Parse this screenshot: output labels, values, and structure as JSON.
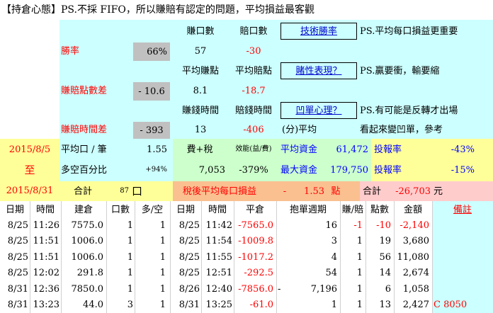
{
  "title": "【持倉心態】PS.不採 FIFO，所以賺賠有認定的問題，平均損益最客觀",
  "buttons": {
    "tech_win": "技術勝率",
    "gamble": "賭性表現？",
    "pit": "凹單心理？"
  },
  "notes": {
    "avg_pnl": "PS.平均每口損益更重要",
    "big_win": "PS.贏要衝，輸要縮",
    "reverse": "PS.有可能是反轉才出場",
    "looks": "看起來變凹單，參考",
    "per_avg": "(分)平均"
  },
  "stats": {
    "win_lots_label": "賺口數",
    "loss_lots_label": "賠口數",
    "win_lots": "57",
    "loss_lots": "-30",
    "win_rate_label": "勝率",
    "win_rate": "66%",
    "avg_win_pts_label": "平均賺點",
    "avg_loss_pts_label": "平均賠點",
    "avg_win_pts": "8.1",
    "avg_loss_pts": "-18.7",
    "pts_diff_label": "賺賠點數差",
    "pts_diff": "- 10.6",
    "win_time_label": "賺錢時間",
    "loss_time_label": "賠錢時間",
    "win_time": "13",
    "loss_time": "-406",
    "time_diff_label": "賺賠時間差",
    "time_diff": "- 393"
  },
  "period": {
    "from": "2015/8/5",
    "to_word": "至",
    "to": "2015/8/31"
  },
  "summary": {
    "avg_lot_label": "平均口 / 筆",
    "avg_lot": "1.55",
    "fee_tax_label": "費+稅",
    "fee_tax": "7,053",
    "efficiency_label": "效能(益/費)",
    "efficiency": "-379%",
    "avg_capital_label": "平均資金",
    "avg_capital": "61,472",
    "roi1_label": "投報率",
    "roi1": "-43%",
    "long_short_label": "多空百分比",
    "long_short": "+94%",
    "max_capital_label": "最大資金",
    "max_capital": "179,750",
    "roi2_label": "投報率",
    "roi2": "-15%",
    "total_label": "合計",
    "total_lots": "87",
    "total_lots_unit": "口",
    "after_tax_label": "稅後平均每口損益",
    "after_tax_sign": "-",
    "after_tax_value": "1.53",
    "after_tax_unit": "點",
    "total2_label": "合計",
    "total_amount": "-26,703",
    "total_amount_unit": "元"
  },
  "table": {
    "headers": [
      "日期",
      "時間",
      "建倉",
      "口數",
      "多/空",
      "日期",
      "時間",
      "平倉",
      "抱單週期",
      "賺/賠",
      "點數",
      "金額",
      "備註"
    ],
    "rows": [
      [
        "8/25",
        "11:26",
        "7575.0",
        "1",
        "1",
        "8/25",
        "11:42",
        "-7565.0",
        "",
        "16",
        "-1",
        "-10",
        "-2,140",
        ""
      ],
      [
        "8/25",
        "11:51",
        "1006.0",
        "1",
        "1",
        "8/25",
        "11:54",
        "-1009.8",
        "",
        "3",
        "1",
        "19",
        "3,680",
        ""
      ],
      [
        "8/25",
        "11:51",
        "1006.0",
        "1",
        "1",
        "8/25",
        "11:55",
        "-1017.2",
        "",
        "4",
        "1",
        "56",
        "11,080",
        ""
      ],
      [
        "8/25",
        "12:02",
        "291.8",
        "1",
        "1",
        "8/25",
        "12:51",
        "-292.5",
        "",
        "54",
        "1",
        "14",
        "2,674",
        ""
      ],
      [
        "8/31",
        "12:36",
        "7850.0",
        "1",
        "1",
        "8/26",
        "12:40",
        "-7856.0",
        "-",
        "7,196",
        "1",
        "6",
        "1,058",
        ""
      ],
      [
        "8/31",
        "13:23",
        "44.0",
        "3",
        "1",
        "8/31",
        "13:25",
        "-61.0",
        "",
        "1",
        "1",
        "13",
        "2,427",
        "C 8050"
      ]
    ]
  }
}
